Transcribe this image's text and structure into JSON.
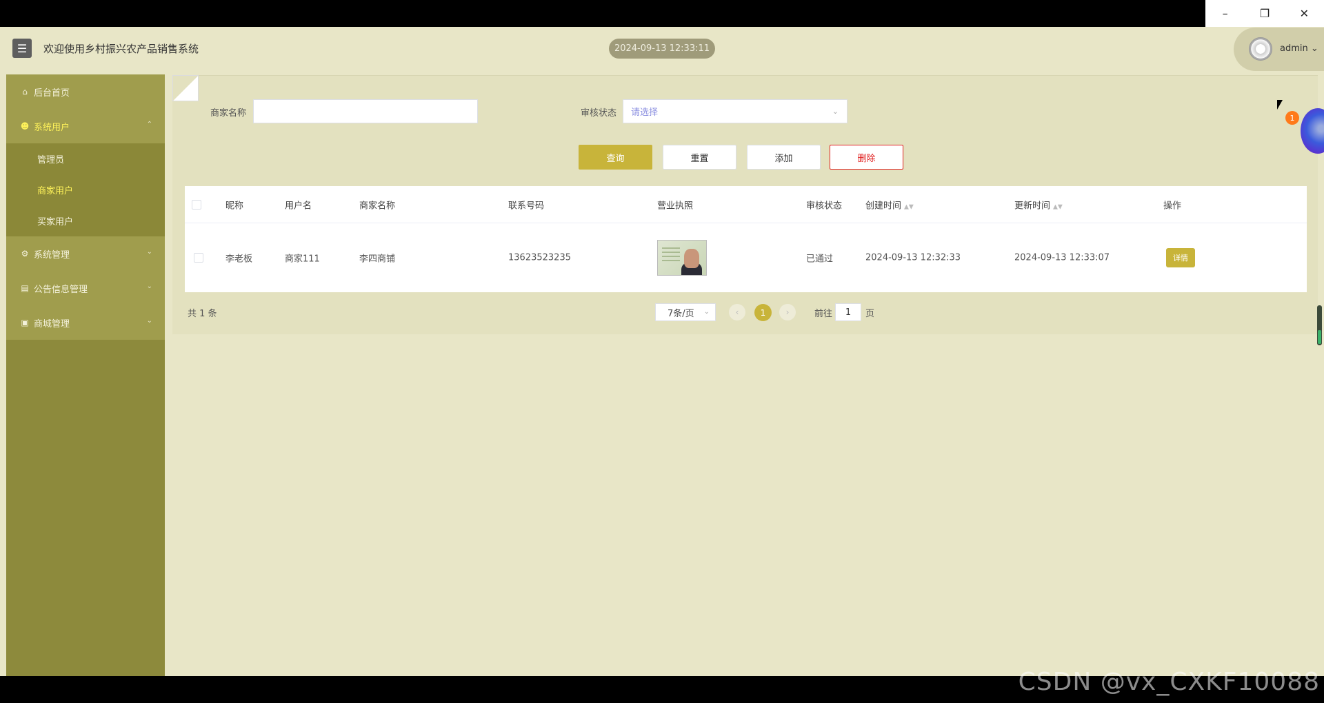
{
  "window": {
    "minimize_icon": "minimize-icon",
    "restore_icon": "restore-icon",
    "close_icon": "close-icon"
  },
  "header": {
    "title": "欢迎使用乡村振兴农产品销售系统",
    "datetime": "2024-09-13 12:33:11",
    "username": "admin",
    "notification_count": "1"
  },
  "sidebar": {
    "items": [
      {
        "label": "后台首页",
        "icon": "home-icon"
      },
      {
        "label": "系统用户",
        "icon": "user-icon",
        "expanded": true,
        "children": [
          "管理员",
          "商家用户",
          "买家用户"
        ],
        "active_child": "商家用户"
      },
      {
        "label": "系统管理",
        "icon": "gear-icon"
      },
      {
        "label": "公告信息管理",
        "icon": "document-icon"
      },
      {
        "label": "商城管理",
        "icon": "shop-icon"
      }
    ]
  },
  "search": {
    "merchant_name_label": "商家名称",
    "merchant_name_value": "",
    "audit_status_label": "审核状态",
    "audit_status_placeholder": "请选择"
  },
  "actions": {
    "query": "查询",
    "reset": "重置",
    "add": "添加",
    "delete": "删除"
  },
  "table": {
    "columns": [
      "昵称",
      "用户名",
      "商家名称",
      "联系号码",
      "营业执照",
      "审核状态",
      "创建时间",
      "更新时间",
      "操作"
    ],
    "rows": [
      {
        "nickname": "李老板",
        "username": "商家111",
        "merchant_name": "李四商铺",
        "phone": "13623523235",
        "license": "business-license-image",
        "status": "已通过",
        "created": "2024-09-13 12:32:33",
        "updated": "2024-09-13 12:33:07",
        "action": "详情"
      }
    ]
  },
  "pagination": {
    "total": "共 1 条",
    "page_size": "7条/页",
    "current_page": "1",
    "goto_prefix": "前往",
    "goto_value": "1",
    "goto_suffix": "页"
  },
  "watermark": "CSDN @vx_CXKF10088",
  "colors": {
    "accent": "#c8b43a",
    "sidebar": "#8d8a3c",
    "background": "#e8e6c7",
    "active_text": "#fff35a",
    "danger": "#e02020"
  }
}
